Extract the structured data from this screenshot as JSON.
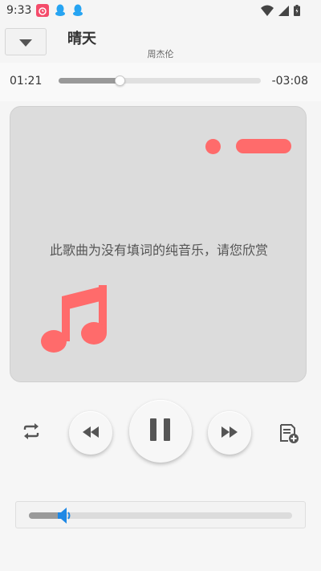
{
  "status_bar": {
    "time": "9:33",
    "icons": [
      "alarm-app-icon",
      "qq-icon",
      "qq-icon",
      "wifi-icon",
      "signal-icon",
      "battery-icon"
    ]
  },
  "header": {
    "title": "晴天",
    "artist": "周杰伦"
  },
  "progress": {
    "current": "01:21",
    "remaining": "-03:08",
    "fraction": 0.3
  },
  "lyrics": {
    "message": "此歌曲为没有填词的纯音乐，请您欣赏"
  },
  "volume": {
    "level": 0.12
  },
  "colors": {
    "accent": "#ff6b6b",
    "volume_icon": "#1e88e5",
    "card_bg": "#dcdcdc"
  }
}
